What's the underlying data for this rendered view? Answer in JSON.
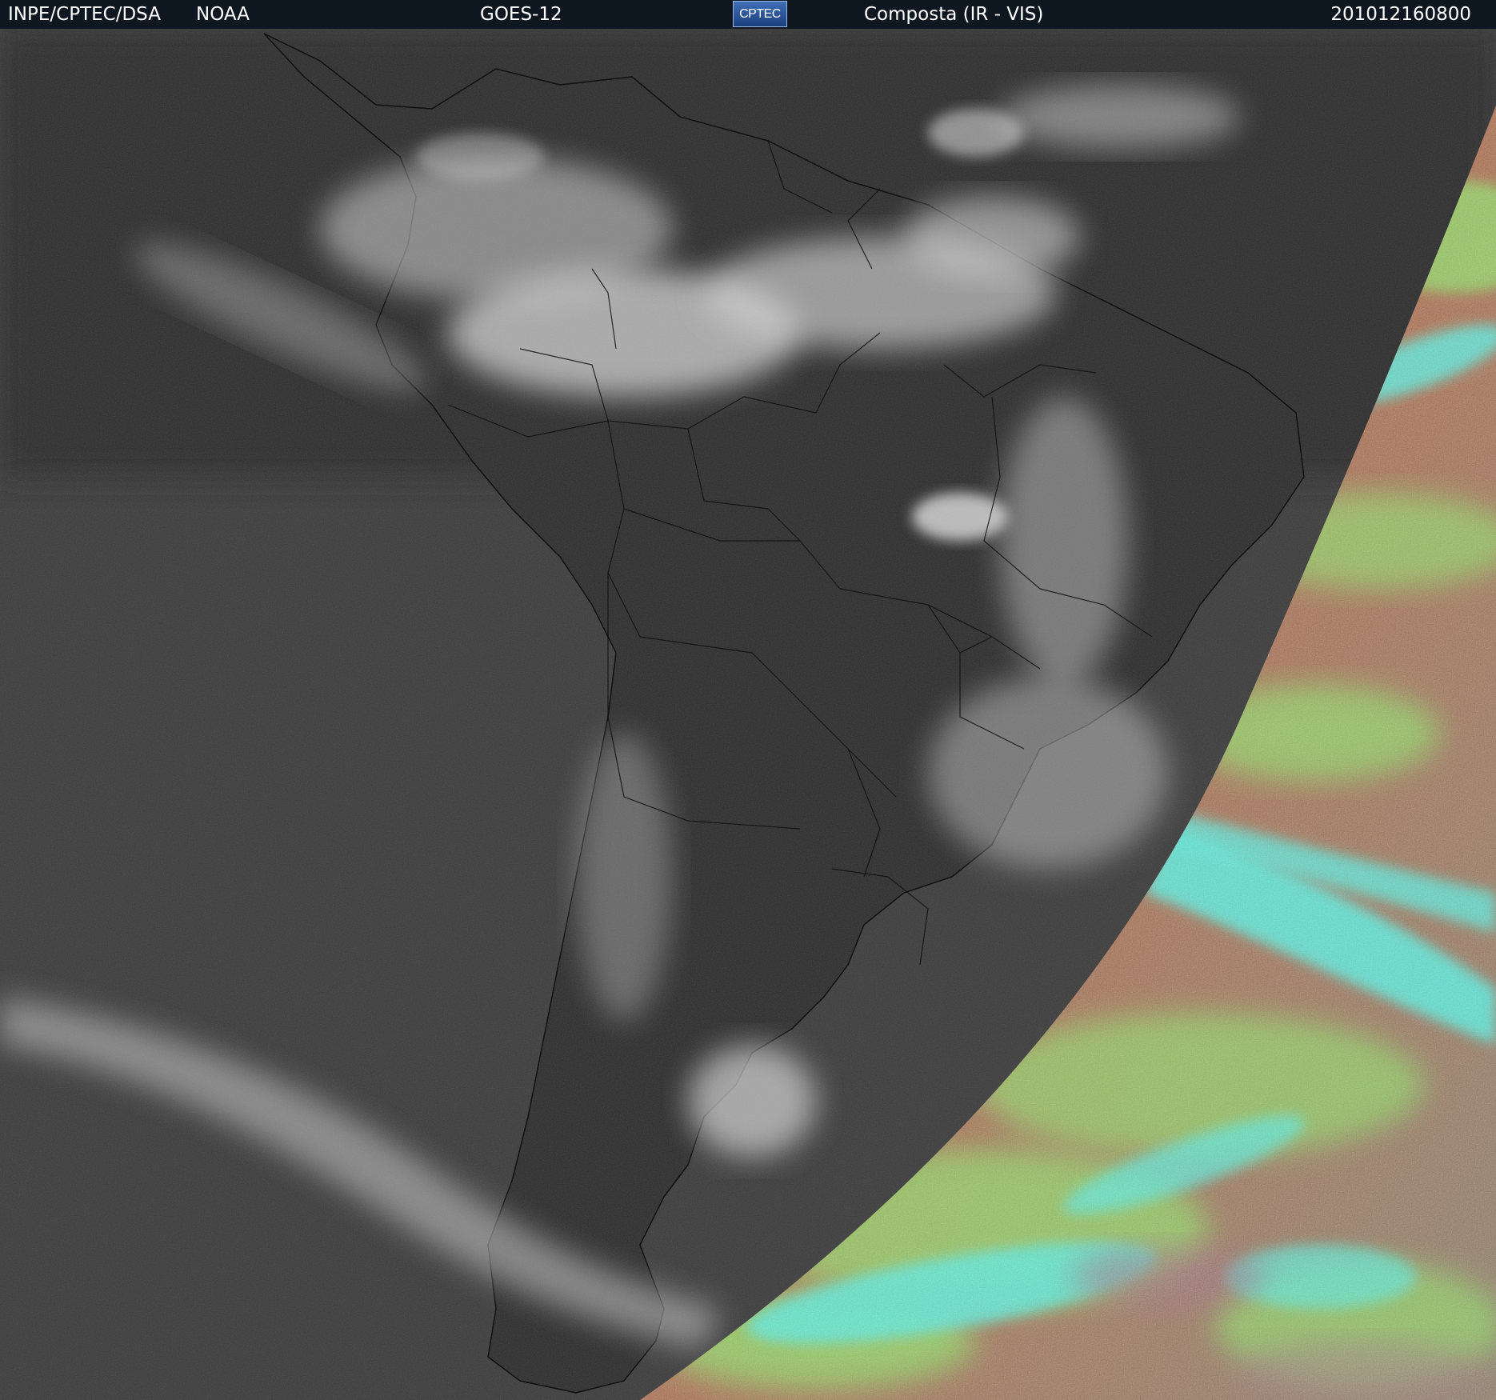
{
  "header": {
    "source": "INPE/CPTEC/DSA",
    "agency": "NOAA",
    "satellite": "GOES-12",
    "logo_text": "CPTEC",
    "product": "Composta (IR - VIS)",
    "timestamp": "201012160800"
  },
  "colors": {
    "header_bg": "#0e1620",
    "header_text": "#ffffff",
    "ocean_ir": "#3b3b3b",
    "land_ir": "#2b2b2b",
    "cloud_ir": "#d4d4d4",
    "vis_surface": "#b06a48",
    "vis_low_cloud": "#8fe05e",
    "vis_high_cloud": "#52f0e0",
    "border_lines": "#000000"
  },
  "map": {
    "region": "South America",
    "projection": "satellite composite",
    "left_half_channel": "IR",
    "right_side_channel": "VIS"
  }
}
